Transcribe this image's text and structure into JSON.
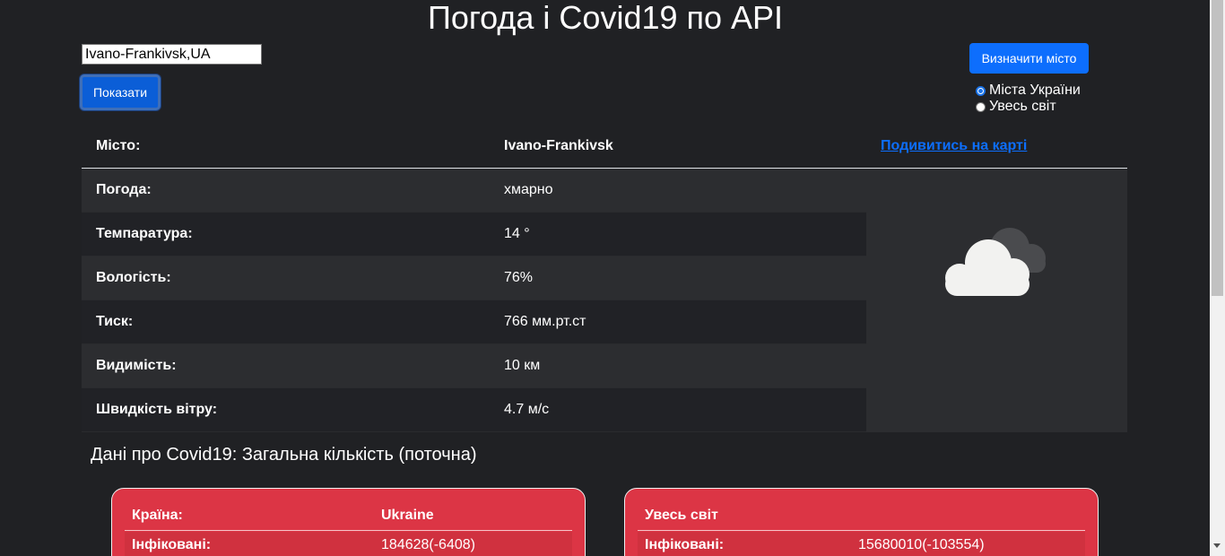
{
  "header": {
    "title": "Погода і Covid19 по API"
  },
  "search": {
    "value": "Ivano-Frankivsk,UA",
    "show_label": "Показати"
  },
  "locate": {
    "button_label": "Визначити місто",
    "options": [
      {
        "label": "Міста України",
        "checked": true
      },
      {
        "label": "Увесь світ",
        "checked": false
      }
    ]
  },
  "weather": {
    "head": {
      "key": "Місто:",
      "value": "Ivano-Frankivsk",
      "map_link": "Подивитись на карті"
    },
    "rows": [
      {
        "key": "Погода:",
        "value": "хмарно"
      },
      {
        "key": "Темпаратура:",
        "value": "14 °"
      },
      {
        "key": "Вологість:",
        "value": "76%"
      },
      {
        "key": "Тиск:",
        "value": "766 мм.рт.ст"
      },
      {
        "key": "Видимість:",
        "value": "10 км"
      },
      {
        "key": "Швидкість вітру:",
        "value": "4.7 м/с"
      }
    ],
    "icon": "cloud-icon"
  },
  "covid": {
    "title": "Дані про Covid19: Загальна кількість (поточна)",
    "country_card": {
      "head_key": "Країна:",
      "head_value": "Ukraine",
      "row_key": "Інфіковані:",
      "row_value": "184628(-6408)"
    },
    "world_card": {
      "head_key": "Увесь світ",
      "row_key": "Інфіковані:",
      "row_value": "15680010(-103554)"
    }
  },
  "colors": {
    "background": "#202124",
    "primary": "#0d6efd",
    "danger": "#dc3545"
  }
}
